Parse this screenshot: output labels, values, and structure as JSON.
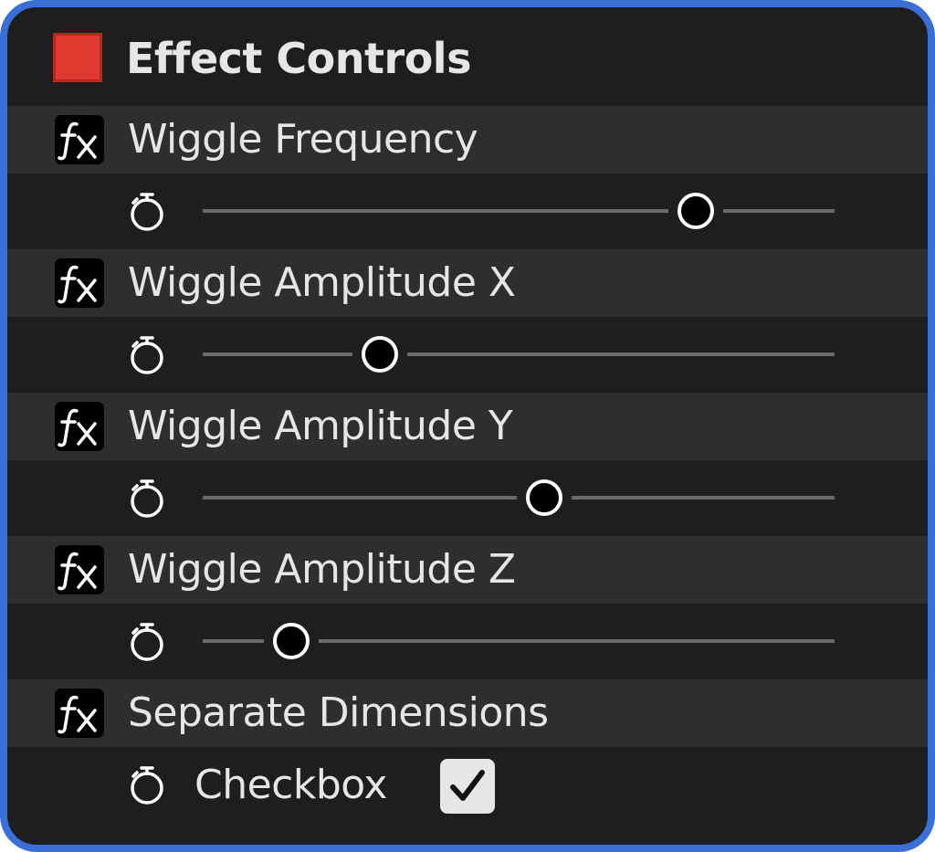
{
  "panel": {
    "title": "Effect Controls",
    "title_swatch_color": "#e03a30",
    "border_color": "#3a6fd8"
  },
  "effects": [
    {
      "label": "Wiggle Frequency",
      "icon": "fx-icon",
      "control": "slider",
      "value": 0.78
    },
    {
      "label": "Wiggle Amplitude X",
      "icon": "fx-icon",
      "control": "slider",
      "value": 0.28
    },
    {
      "label": "Wiggle Amplitude Y",
      "icon": "fx-icon",
      "control": "slider",
      "value": 0.54
    },
    {
      "label": "Wiggle Amplitude Z",
      "icon": "fx-icon",
      "control": "slider",
      "value": 0.14
    },
    {
      "label": "Separate Dimensions",
      "icon": "fx-icon",
      "control": "checkbox",
      "checkbox_label": "Checkbox",
      "checked": true
    }
  ],
  "stopwatch_icon": "stopwatch-icon"
}
